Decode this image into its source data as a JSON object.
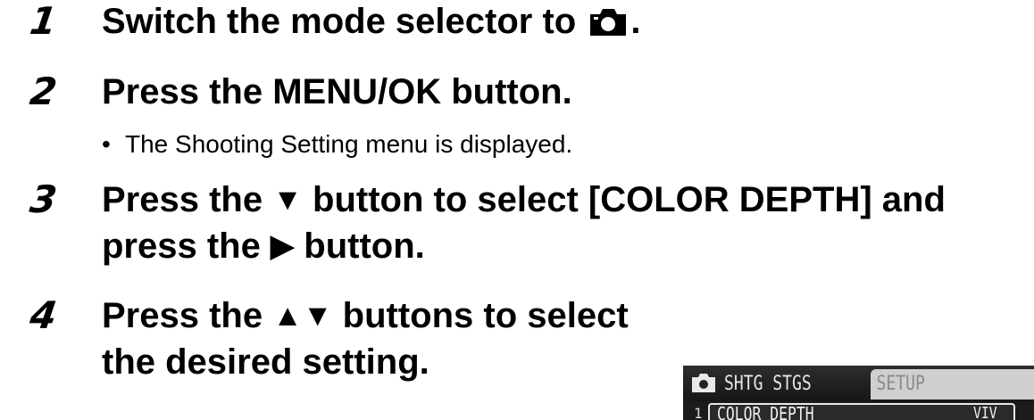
{
  "steps": [
    {
      "number": "1",
      "line1_before": "Switch the mode selector to",
      "line1_after": ".",
      "icon": "camera-icon"
    },
    {
      "number": "2",
      "line1": "Press the MENU/OK button.",
      "bullet": "The Shooting Setting menu is displayed."
    },
    {
      "number": "3",
      "line1_before": "Press the",
      "line1_glyph": "▼",
      "line1_after": "button to select [COLOR DEPTH] and",
      "line2_before": "press the",
      "line2_glyph": "▶",
      "line2_after": "button."
    },
    {
      "number": "4",
      "line1_before": "Press the",
      "line1_glyph": "▲▼",
      "line1_after": "buttons to select",
      "line2": "the desired setting."
    }
  ],
  "bullet_char": "•",
  "lcd": {
    "tab_active": "SHTG STGS",
    "tab_inactive": "SETUP",
    "row_index": "1",
    "row_label": "COLOR DEPTH",
    "row_value": "VIV"
  }
}
